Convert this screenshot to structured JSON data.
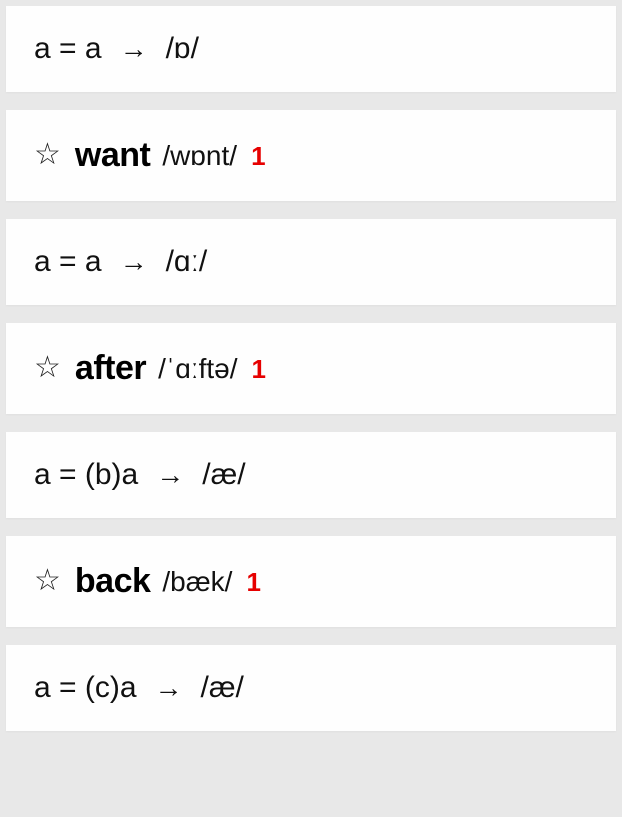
{
  "rows": {
    "r1": {
      "lhs": "a = a",
      "arrow": "→",
      "rhs": "/ɒ/"
    },
    "r2": {
      "word": "want",
      "ipa": "/wɒnt/",
      "count": "1"
    },
    "r3": {
      "lhs": "a = a",
      "arrow": "→",
      "rhs": "/ɑː/"
    },
    "r4": {
      "word": "after",
      "ipa": "/ˈɑːftə/",
      "count": "1"
    },
    "r5": {
      "lhs": "a = (b)a",
      "arrow": "→",
      "rhs": "/æ/"
    },
    "r6": {
      "word": "back",
      "ipa": "/bæk/",
      "count": "1"
    },
    "r7": {
      "lhs": "a = (c)a",
      "arrow": "→",
      "rhs": "/æ/"
    }
  }
}
